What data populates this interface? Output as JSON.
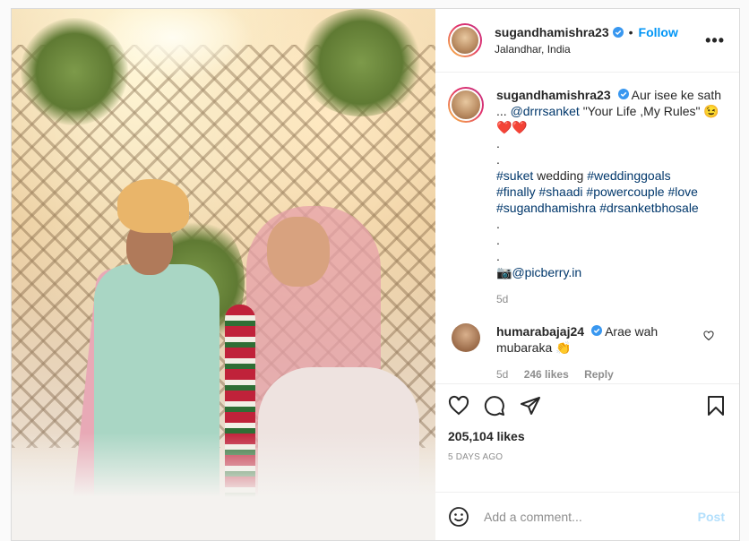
{
  "header": {
    "username": "sugandhamishra23",
    "dot": "•",
    "follow_label": "Follow",
    "location": "Jalandhar, India",
    "more_label": "•••"
  },
  "caption": {
    "username": "sugandhamishra23",
    "text1": "Aur isee ke sath ...",
    "mention1": "@drrrsanket",
    "text2": "\"Your Life ,My Rules\"",
    "emoji": "😉❤️❤️",
    "dot": ".",
    "tag_suket": "#suket",
    "word_wedding": "wedding",
    "tag_weddinggoals": "#weddinggoals",
    "tag_finally": "#finally",
    "tag_shaadi": "#shaadi",
    "tag_powercouple": "#powercouple",
    "tag_love": "#love",
    "tag_sugandhamishra": "#sugandhamishra",
    "tag_drsanketbhosale": "#drsanketbhosale",
    "camera_emoji": "📷",
    "mention2": "@picberry.in",
    "age": "5d"
  },
  "comment": {
    "username": "humarabajaj24",
    "text": "Arae wah mubaraka",
    "emoji": "👏",
    "age": "5d",
    "likes": "246 likes",
    "reply_label": "Reply"
  },
  "actions": {
    "likes": "205,104 likes",
    "time_ago": "5 DAYS AGO"
  },
  "add_comment": {
    "placeholder": "Add a comment...",
    "post_label": "Post"
  },
  "colors": {
    "accent": "#0095f6",
    "post_disabled": "#b2dffc",
    "hashtag": "#00376b",
    "muted": "#8e8e8e"
  },
  "icons": [
    "verified-icon",
    "heart-icon",
    "comment-icon",
    "share-icon",
    "save-icon",
    "emoji-icon",
    "comment-like-icon",
    "more-icon"
  ]
}
